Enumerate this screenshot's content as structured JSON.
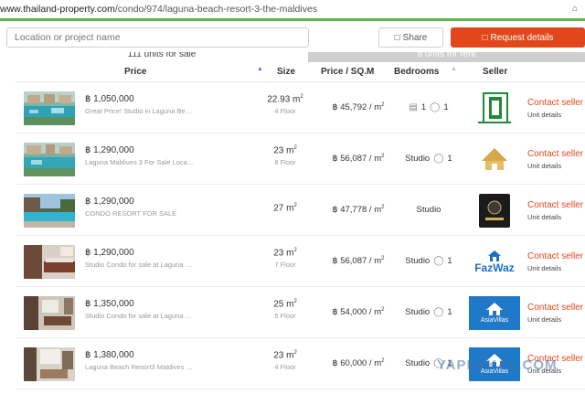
{
  "browser": {
    "url_domain": "www.thailand-property.com",
    "url_path": "/condo/974/laguna-beach-resort-3-the-maldives"
  },
  "topbar": {
    "search_placeholder": "Location or project name",
    "share_label": "Share",
    "request_label": "Request details",
    "accent": "#e2471c"
  },
  "tabs": {
    "sale_label": "111 units for sale",
    "rent_label": "9 units for rent"
  },
  "table": {
    "headers": {
      "price": "Price",
      "size": "Size",
      "psqm": "Price / SQ.M",
      "bedrooms": "Bedrooms",
      "seller": "Seller"
    },
    "rows": [
      {
        "price": "฿ 1,050,000",
        "description": "Great Price! Studio in Laguna Bea...",
        "size": "22.93 m",
        "size_unit_sup": "2",
        "floor": "4 Floor",
        "price_per_sqm": "฿ 45,792 / m",
        "bedrooms": "1",
        "bathrooms": "1",
        "seller_logo": "door-logo",
        "contact": "Contact seller",
        "unit_details": "Unit details"
      },
      {
        "price": "฿ 1,290,000",
        "description": "Laguna Maldives 3 For Sale Locati...",
        "size": "23 m",
        "size_unit_sup": "2",
        "floor": "8 Floor",
        "price_per_sqm": "฿ 56,087 / m",
        "bedrooms": "Studio",
        "bathrooms": "1",
        "seller_logo": "gold-house-logo",
        "contact": "Contact seller",
        "unit_details": "Unit details"
      },
      {
        "price": "฿ 1,290,000",
        "description": "CONDO RESORT FOR SALE",
        "size": "27 m",
        "size_unit_sup": "2",
        "floor": "",
        "price_per_sqm": "฿ 47,778 / m",
        "bedrooms": "Studio",
        "bathrooms": "",
        "seller_logo": "dark-badge-logo",
        "contact": "Contact seller",
        "unit_details": "Unit details"
      },
      {
        "price": "฿ 1,290,000",
        "description": "Studio Condo for sale at Laguna B...",
        "size": "23 m",
        "size_unit_sup": "2",
        "floor": "7 Floor",
        "price_per_sqm": "฿ 56,087 / m",
        "bedrooms": "Studio",
        "bathrooms": "1",
        "seller_logo": "fazwaz-logo",
        "seller_logo_text": "FazWaz",
        "contact": "Contact seller",
        "unit_details": "Unit details"
      },
      {
        "price": "฿ 1,350,000",
        "description": "Studio Condo for sale at Laguna B...",
        "size": "25 m",
        "size_unit_sup": "2",
        "floor": "5 Floor",
        "price_per_sqm": "฿ 54,000 / m",
        "bedrooms": "Studio",
        "bathrooms": "1",
        "seller_logo": "asiavillas-logo",
        "seller_logo_text": "AsiaVillas",
        "contact": "Contact seller",
        "unit_details": "Unit details"
      },
      {
        "price": "฿ 1,380,000",
        "description": "Laguna Beach Resort3 Maldives S...",
        "size": "23 m",
        "size_unit_sup": "2",
        "floor": "4 Floor",
        "price_per_sqm": "฿ 60,000 / m",
        "bedrooms": "Studio",
        "bathrooms": "1",
        "seller_logo": "asiavillas-logo",
        "seller_logo_text": "AsiaVillas",
        "contact": "Contact seller",
        "unit_details": "Unit details"
      }
    ]
  },
  "watermark": "YAPLAKAL.COM"
}
